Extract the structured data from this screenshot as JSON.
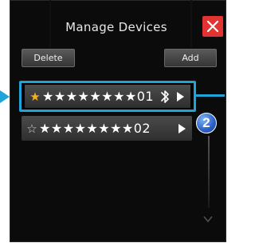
{
  "header": {
    "title": "Manage Devices"
  },
  "toolbar": {
    "delete_label": "Delete",
    "add_label": "Add"
  },
  "devices": [
    {
      "name": "★★★★★★★★01",
      "favorite": true,
      "connected": true,
      "selected": true
    },
    {
      "name": "★★★★★★★★02",
      "favorite": false,
      "connected": false,
      "selected": false
    }
  ],
  "icons": {
    "favorite": "star-filled-icon",
    "not_favorite": "star-outline-icon",
    "connected": "bluetooth-icon",
    "open": "play-arrow-icon",
    "close": "close-icon",
    "scroll": "chevron-down-icon"
  },
  "colors": {
    "accent": "#1fa3d8",
    "close": "#e23333",
    "favorite": "#f3b21b"
  },
  "callout": {
    "step": "2"
  }
}
